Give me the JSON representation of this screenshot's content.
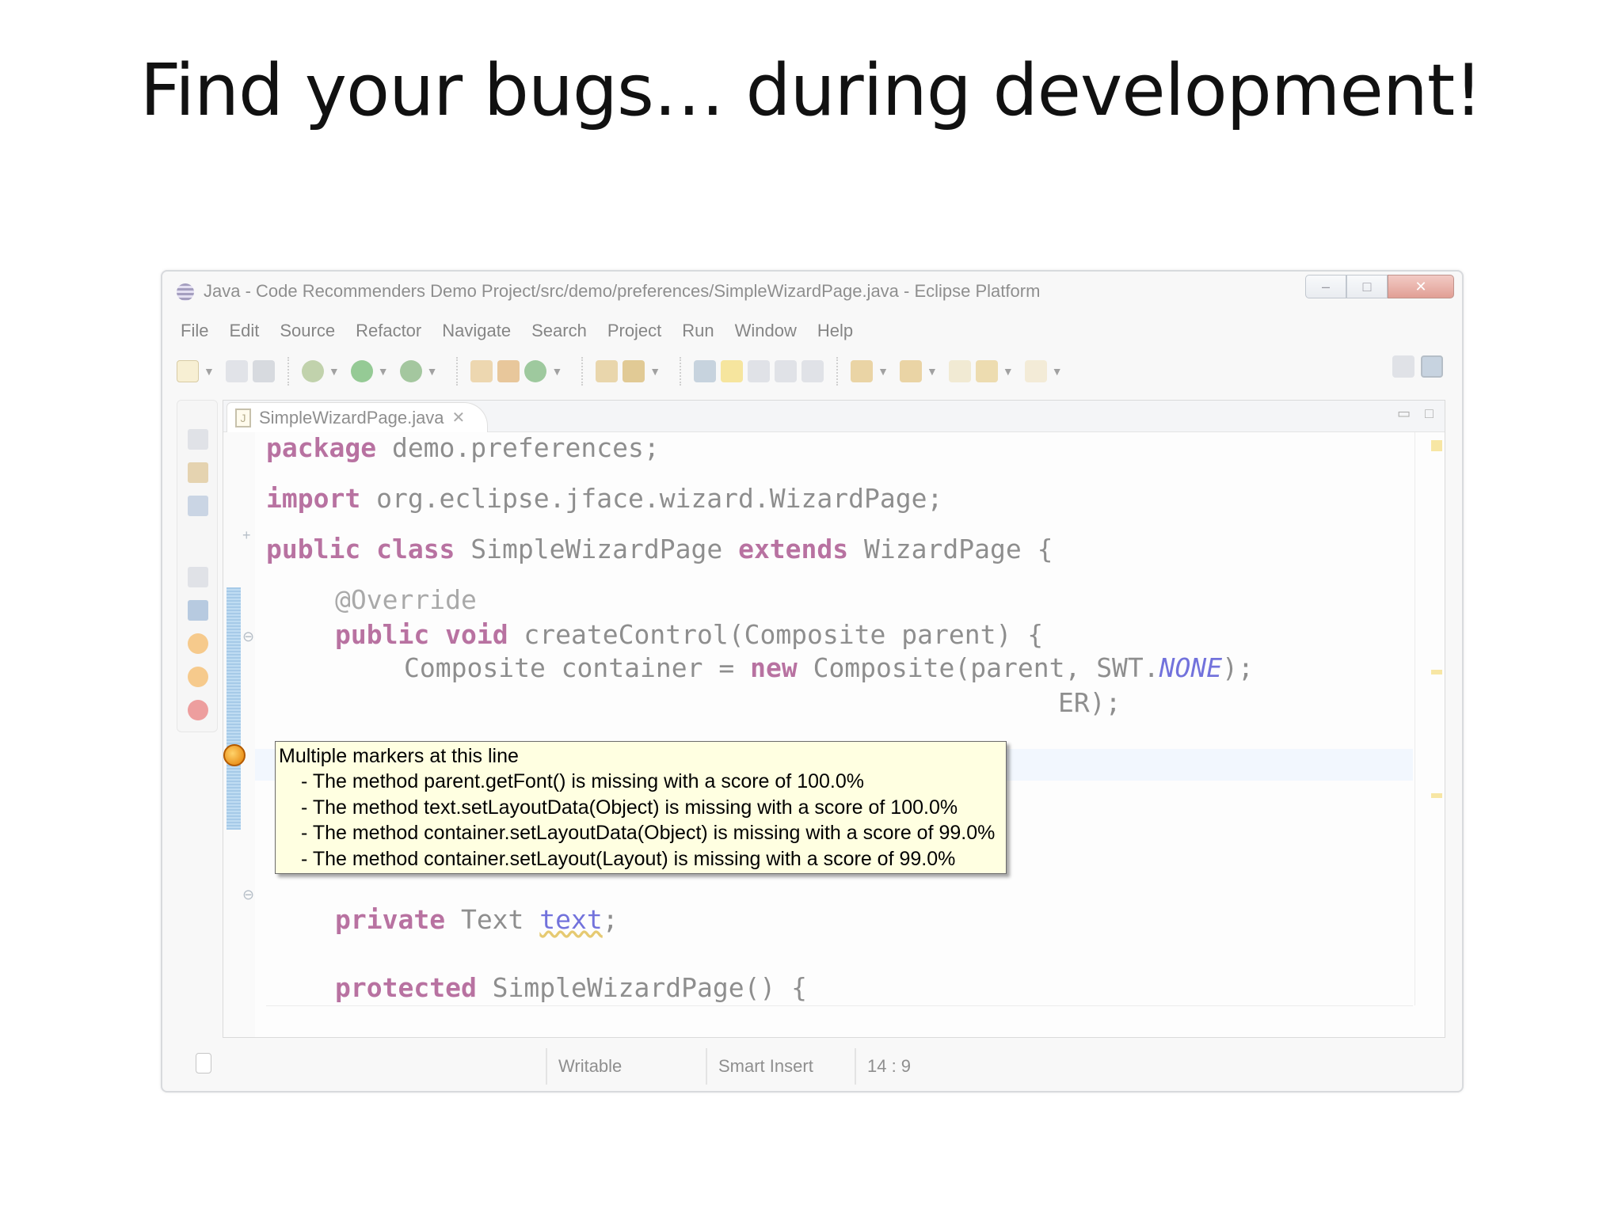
{
  "slide": {
    "title": "Find your bugs… during development!"
  },
  "window": {
    "title": "Java - Code Recommenders Demo Project/src/demo/preferences/SimpleWizardPage.java - Eclipse Platform",
    "controls": {
      "minimize": "–",
      "maximize": "□",
      "close": "✕"
    }
  },
  "menu": [
    "File",
    "Edit",
    "Source",
    "Refactor",
    "Navigate",
    "Search",
    "Project",
    "Run",
    "Window",
    "Help"
  ],
  "editor": {
    "tab_label": "SimpleWizardPage.java",
    "tab_close": "✕",
    "code": {
      "l1_kw": "package",
      "l1_rest": " demo.preferences;",
      "l2_fold": "+",
      "l2_kw": "import",
      "l2_rest": " org.eclipse.jface.wizard.WizardPage;",
      "l3_kw1": "public",
      "l3_kw2": " class",
      "l3_mid": " SimpleWizardPage",
      "l3_kw3": " extends",
      "l3_rest": " WizardPage {",
      "l4_ann": "@Override",
      "l5_kw1": "public",
      "l5_kw2": " void",
      "l5_rest": " createControl(Composite parent) {",
      "l6_pre": "Composite container = ",
      "l6_kw": "new",
      "l6_mid": " Composite(parent, SWT.",
      "l6_static": "NONE",
      "l6_end": ");",
      "l7_tail": "ER);",
      "l8_kw": "private",
      "l8_type": " Text ",
      "l8_field": "text",
      "l8_end": ";",
      "l9_kw": "protected",
      "l9_rest": " SimpleWizardPage() {"
    }
  },
  "tooltip": {
    "title": "Multiple markers at this line",
    "items": [
      "- The method parent.getFont() is missing with a score of 100.0%",
      "- The method text.setLayoutData(Object) is missing with a score of 100.0%",
      "- The method container.setLayoutData(Object) is missing with a score of 99.0%",
      "- The method container.setLayout(Layout) is missing with a score of 99.0%"
    ]
  },
  "status": {
    "mode": "Writable",
    "insert": "Smart Insert",
    "position": "14 : 9"
  },
  "colors": {
    "keyword": "#7f0055",
    "tooltip_bg": "#ffffe1",
    "field": "#0000c0"
  }
}
